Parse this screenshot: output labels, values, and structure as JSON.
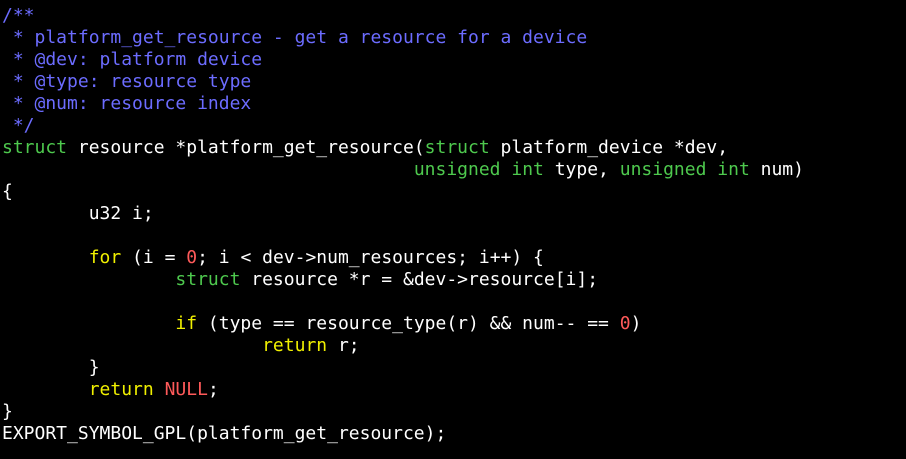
{
  "colors": {
    "background": "#000000",
    "default": "#ffffff",
    "comment": "#6c6cff",
    "type": "#4ec94e",
    "keyword": "#f0f000",
    "number": "#ff5a5a",
    "constant": "#ff5a5a"
  },
  "code_lines": [
    [
      {
        "t": "/**",
        "k": "comment"
      }
    ],
    [
      {
        "t": " * platform_get_resource - get a resource for a device",
        "k": "comment"
      }
    ],
    [
      {
        "t": " * @dev: platform device",
        "k": "comment"
      }
    ],
    [
      {
        "t": " * @type: resource type",
        "k": "comment"
      }
    ],
    [
      {
        "t": " * @num: resource index",
        "k": "comment"
      }
    ],
    [
      {
        "t": " */",
        "k": "comment"
      }
    ],
    [
      {
        "t": "struct",
        "k": "type"
      },
      {
        "t": " resource *platform_get_resource(",
        "k": "default"
      },
      {
        "t": "struct",
        "k": "type"
      },
      {
        "t": " platform_device *dev,",
        "k": "default"
      }
    ],
    [
      {
        "t": "                                      ",
        "k": "default"
      },
      {
        "t": "unsigned",
        "k": "type"
      },
      {
        "t": " ",
        "k": "default"
      },
      {
        "t": "int",
        "k": "type"
      },
      {
        "t": " type, ",
        "k": "default"
      },
      {
        "t": "unsigned",
        "k": "type"
      },
      {
        "t": " ",
        "k": "default"
      },
      {
        "t": "int",
        "k": "type"
      },
      {
        "t": " num)",
        "k": "default"
      }
    ],
    [
      {
        "t": "{",
        "k": "default"
      }
    ],
    [
      {
        "t": "        u32 i;",
        "k": "default"
      }
    ],
    [
      {
        "t": "",
        "k": "default"
      }
    ],
    [
      {
        "t": "        ",
        "k": "default"
      },
      {
        "t": "for",
        "k": "keyword"
      },
      {
        "t": " (i = ",
        "k": "default"
      },
      {
        "t": "0",
        "k": "number"
      },
      {
        "t": "; i < dev->num_resources; i++) {",
        "k": "default"
      }
    ],
    [
      {
        "t": "                ",
        "k": "default"
      },
      {
        "t": "struct",
        "k": "type"
      },
      {
        "t": " resource *r = &dev->resource[i];",
        "k": "default"
      }
    ],
    [
      {
        "t": "",
        "k": "default"
      }
    ],
    [
      {
        "t": "                ",
        "k": "default"
      },
      {
        "t": "if",
        "k": "keyword"
      },
      {
        "t": " (type == resource_type(r) && num-- == ",
        "k": "default"
      },
      {
        "t": "0",
        "k": "number"
      },
      {
        "t": ")",
        "k": "default"
      }
    ],
    [
      {
        "t": "                        ",
        "k": "default"
      },
      {
        "t": "return",
        "k": "keyword"
      },
      {
        "t": " r;",
        "k": "default"
      }
    ],
    [
      {
        "t": "        }",
        "k": "default"
      }
    ],
    [
      {
        "t": "        ",
        "k": "default"
      },
      {
        "t": "return",
        "k": "keyword"
      },
      {
        "t": " ",
        "k": "default"
      },
      {
        "t": "NULL",
        "k": "constant"
      },
      {
        "t": ";",
        "k": "default"
      }
    ],
    [
      {
        "t": "}",
        "k": "default"
      }
    ],
    [
      {
        "t": "EXPORT_SYMBOL_GPL(platform_get_resource);",
        "k": "default"
      }
    ]
  ]
}
